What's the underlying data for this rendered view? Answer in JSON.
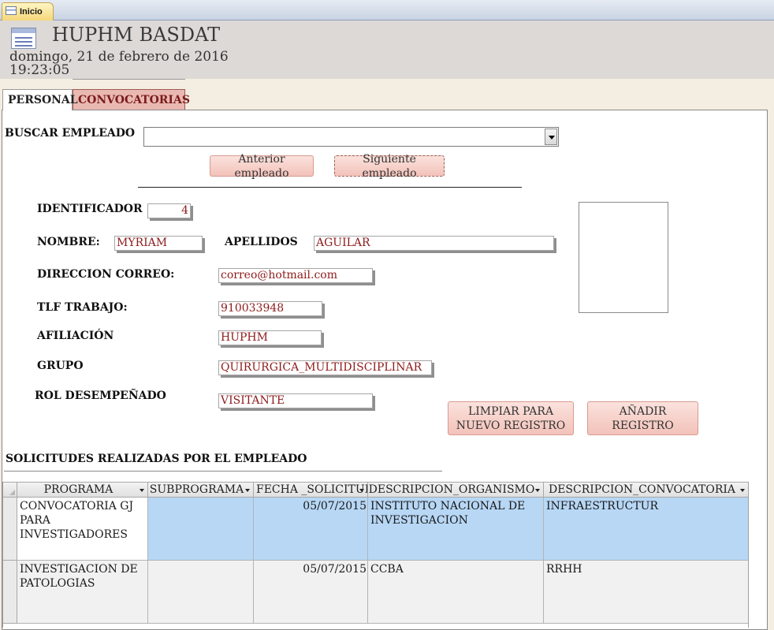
{
  "doc_tab": {
    "label": "Inicio"
  },
  "header": {
    "title": "HUPHM BASDAT",
    "date": "domingo, 21 de febrero de 2016",
    "time": "19:23:05"
  },
  "tabs": [
    {
      "label": "PERSONAL"
    },
    {
      "label": "CONVOCATORIAS"
    }
  ],
  "search": {
    "label": "BUSCAR EMPLEADO",
    "value": ""
  },
  "nav": {
    "prev_label": "Anterior empleado",
    "next_label": "Siguiente empleado"
  },
  "fields": {
    "id_label": "IDENTIFICADOR",
    "id_value": "4",
    "name_label": "NOMBRE:",
    "name_value": "MYRIAM",
    "surname_label": "APELLIDOS",
    "surname_value": "AGUILAR",
    "email_label": "DIRECCION CORREO:",
    "email_value": "correo@hotmail.com",
    "phone_label": "TLF TRABAJO:",
    "phone_value": "910033948",
    "affil_label": "AFILIACIÓN",
    "affil_value": "HUPHM",
    "group_label": "GRUPO",
    "group_value": "QUIRURGICA_MULTIDISCIPLINAR",
    "role_label": "ROL DESEMPEÑADO",
    "role_value": "VISITANTE"
  },
  "actions": {
    "clear_line1": "LIMPIAR PARA",
    "clear_line2": "NUEVO REGISTRO",
    "add_label": "AÑADIR REGISTRO"
  },
  "requests": {
    "title": "SOLICITUDES REALIZADAS POR EL EMPLEADO",
    "columns": [
      "PROGRAMA",
      "SUBPROGRAMA",
      "FECHA _SOLICITUD",
      "DESCRIPCION_ORGANISMO",
      "DESCRIPCION_CONVOCATORIA"
    ],
    "rows": [
      {
        "programa": "CONVOCATORIA GJ PARA INVESTIGADORES",
        "subprograma": "",
        "fecha": "05/07/2015",
        "organismo": "INSTITUTO NACIONAL DE INVESTIGACION",
        "convocatoria": "INFRAESTRUCTUR"
      },
      {
        "programa": "INVESTIGACION DE PATOLOGIAS",
        "subprograma": "",
        "fecha": "05/07/2015",
        "organismo": "CCBA",
        "convocatoria": "RRHH"
      }
    ]
  }
}
